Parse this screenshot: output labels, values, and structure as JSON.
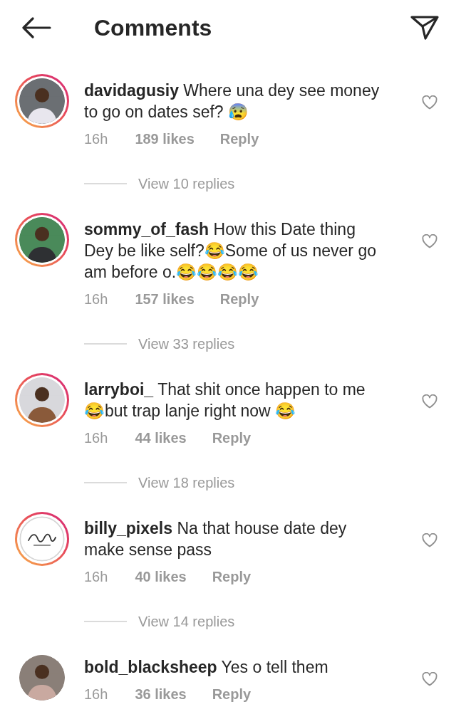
{
  "header": {
    "title": "Comments"
  },
  "comments": [
    {
      "username": "davidagusiy",
      "text": "Where una dey see money to go on dates sef? 😰",
      "time": "16h",
      "likes": "189 likes",
      "reply": "Reply",
      "view_replies": "View 10 replies",
      "story_ring": true,
      "liked": false
    },
    {
      "username": "sommy_of_fash",
      "text": "How this Date thing Dey be like self?😂Some of us never go am before o.😂😂😂😂",
      "time": "16h",
      "likes": "157 likes",
      "reply": "Reply",
      "view_replies": "View 33 replies",
      "story_ring": true,
      "liked": false
    },
    {
      "username": "larryboi_",
      "text": "That shit once happen to me 😂but trap lanje right now 😂",
      "time": "16h",
      "likes": "44 likes",
      "reply": "Reply",
      "view_replies": "View 18 replies",
      "story_ring": true,
      "liked": false
    },
    {
      "username": "billy_pixels",
      "text": "Na that house date dey make sense pass",
      "time": "16h",
      "likes": "40 likes",
      "reply": "Reply",
      "view_replies": "View 14 replies",
      "story_ring": true,
      "liked": false
    },
    {
      "username": "bold_blacksheep",
      "text": "Yes o tell them",
      "time": "16h",
      "likes": "36 likes",
      "reply": "Reply",
      "story_ring": false,
      "liked": false
    }
  ]
}
